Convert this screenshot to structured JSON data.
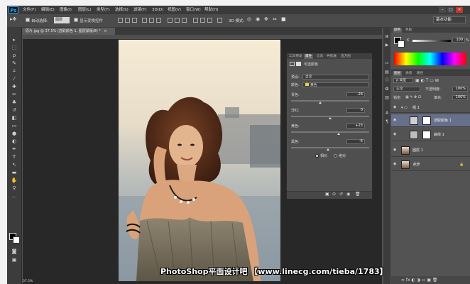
{
  "app": {
    "logo": "Ps"
  },
  "menu": [
    "文件(F)",
    "编辑(E)",
    "图像(I)",
    "图层(L)",
    "类型(Y)",
    "选择(S)",
    "滤镜(T)",
    "3D(D)",
    "视图(V)",
    "窗口(W)",
    "帮助(H)"
  ],
  "window_controls": {
    "minimize": "–",
    "maximize": "□",
    "close": "✕"
  },
  "options": {
    "auto_select_label": "自动选择:",
    "auto_select_value": "图层",
    "show_transform_label": "显示变换控件",
    "mode_3d_label": "3D 模式:",
    "workspace": "基本功能"
  },
  "document": {
    "tab_title": "原片.jpg @ 37.5% (选取颜色 1, 图层蒙版/8) *",
    "tab_close": "×"
  },
  "properties": {
    "tabs": [
      "工具预设",
      "属性",
      "信息",
      "导航器",
      "直方图"
    ],
    "title": "可选颜色",
    "preset_label": "预设:",
    "preset_value": "自定",
    "colors_label": "颜色:",
    "colors_value": "黄色",
    "sliders": [
      {
        "label": "青色:",
        "value": "-26",
        "pos": 0.37
      },
      {
        "label": "洋红:",
        "value": "0",
        "pos": 0.5
      },
      {
        "label": "黄色:",
        "value": "+23",
        "pos": 0.61
      },
      {
        "label": "黑色:",
        "value": "-6",
        "pos": 0.47
      }
    ],
    "method_relative": "相对",
    "method_absolute": "绝对"
  },
  "color_panel": {
    "tabs": [
      "颜色",
      "色板"
    ],
    "channel": "K",
    "value": "100",
    "unit": "%"
  },
  "layers_panel": {
    "tabs": [
      "图层",
      "通道",
      "路径"
    ],
    "filter_kind": "ρ 类型",
    "blend_mode": "正常",
    "opacity_label": "不透明度:",
    "opacity_value": "100%",
    "lock_label": "锁定:",
    "fill_label": "填充:",
    "fill_value": "100%",
    "layers": [
      {
        "name": "组 1",
        "type": "group"
      },
      {
        "name": "选取颜色 1",
        "type": "adjustment",
        "selected": true
      },
      {
        "name": "曲线 1",
        "type": "adjustment"
      },
      {
        "name": "图层 1",
        "type": "pixel"
      },
      {
        "name": "背景",
        "type": "pixel"
      }
    ]
  },
  "status": {
    "zoom": "37.5%"
  },
  "watermark": "PhotoShop平面设计吧  【www.linecg.com/tieba/1783】",
  "colors": {
    "accent": "#31a8ff",
    "selected_layer": "#67708a"
  }
}
